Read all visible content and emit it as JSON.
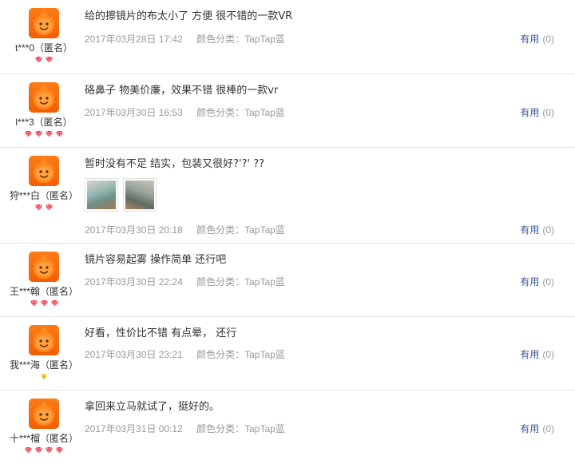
{
  "reviews": [
    {
      "user": "t***0（匿名）",
      "level_icon": "red-heart-diamond",
      "level": 2,
      "text": "给的擦镜片的布太小了 方便 很不错的一款VR",
      "date": "2017年03月28日 17:42",
      "color_label": "颜色分类：TapTap蓝",
      "helpful_label": "有用",
      "helpful_count": "(0)",
      "photos": []
    },
    {
      "user": "l***3（匿名）",
      "level_icon": "red-heart-diamond",
      "level": 4,
      "text": "硌鼻子 物美价廉，效果不错 很棒的一款vr",
      "date": "2017年03月30日 16:53",
      "color_label": "颜色分类：TapTap蓝",
      "helpful_label": "有用",
      "helpful_count": "(0)",
      "photos": []
    },
    {
      "user": "狩***白（匿名）",
      "level_icon": "red-heart-diamond",
      "level": 2,
      "text": "暂时没有不足 结实，包装又很好?'?' ??",
      "date": "2017年03月30日 20:18",
      "color_label": "颜色分类：TapTap蓝",
      "helpful_label": "有用",
      "helpful_count": "(0)",
      "photos": [
        "photo-thumbnail-1",
        "photo-thumbnail-2"
      ]
    },
    {
      "user": "王***翰（匿名）",
      "level_icon": "red-heart-diamond",
      "level": 3,
      "text": "镜片容易起雾 操作简单 还行吧",
      "date": "2017年03月30日 22:24",
      "color_label": "颜色分类：TapTap蓝",
      "helpful_label": "有用",
      "helpful_count": "(0)",
      "photos": []
    },
    {
      "user": "我***海（匿名）",
      "level_icon": "yellow-diamond",
      "level": 1,
      "text": "好看，性价比不错 有点晕， 还行",
      "date": "2017年03月30日 23:21",
      "color_label": "颜色分类：TapTap蓝",
      "helpful_label": "有用",
      "helpful_count": "(0)",
      "photos": []
    },
    {
      "user": "十***榴（匿名）",
      "level_icon": "red-heart-diamond",
      "level": 4,
      "text": "拿回来立马就试了，挺好的。",
      "date": "2017年03月31日 00:12",
      "color_label": "颜色分类：TapTap蓝",
      "helpful_label": "有用",
      "helpful_count": "(0)",
      "photos": []
    }
  ],
  "colors": {
    "avatar": "#f86a0c",
    "gem_red": "#e8344a",
    "gem_yellow": "#f5b400",
    "helpful_link": "#3c5a99",
    "meta_text": "#999999",
    "divider": "#e6e6e6"
  }
}
